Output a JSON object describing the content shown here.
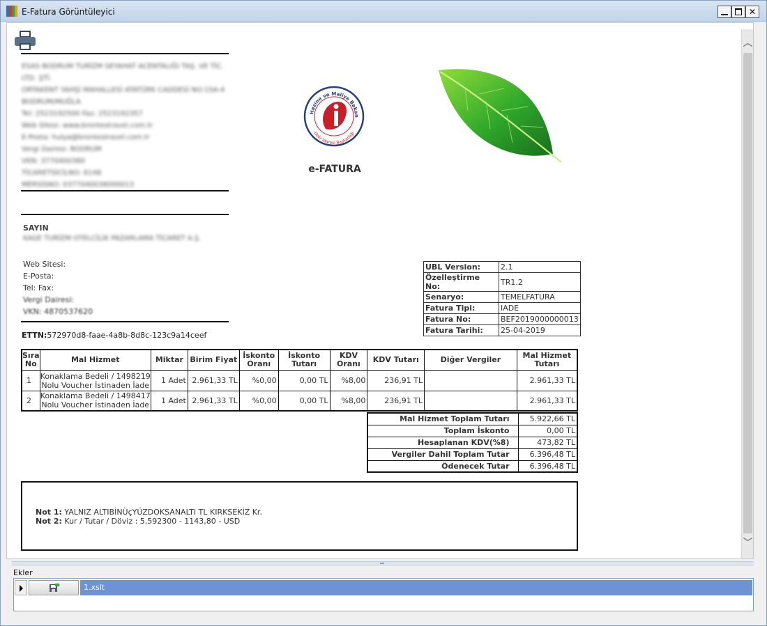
{
  "window": {
    "title": "E-Fatura Görüntüleyici"
  },
  "sender": {
    "lines": [
      "ESAS BODRUM TURİZM SEYAHAT ACENTALIĞI TAŞ. VE TİC.",
      "LTD. ŞTİ.",
      "ORTAKENT YAHŞİ MAHALLESİ ATATÜRK CADDESİ NO:15A-4",
      "BODRUM/MUĞLA",
      "Tel: 2523192500 Fax: 2523192357",
      "Web Sitesi: www.brontestravel.com.tr",
      "E-Posta: hulya@brontestravel.com.tr",
      "Vergi Dairesi: BODRUM",
      "VKN: 3770400380",
      "TİCARETSİCİLNO: 6148",
      "MERSİSNO: 0377040038000013"
    ]
  },
  "recipient": {
    "sayin": "SAYIN",
    "name": "KAGE TURİZM OTELCİLİK PAZARLAMA TİCARET A.Ş.",
    "web": "Web Sitesi:",
    "email": "E-Posta:",
    "tel": "Tel: Fax:",
    "tax_office": "Vergi Dairesi:",
    "vkn": "VKN: 4870537620"
  },
  "ettn": {
    "label": "ETTN:",
    "value": "572970d8-faae-4a8b-8d8c-123c9a14ceef"
  },
  "header": {
    "title": "e-FATURA"
  },
  "meta": [
    {
      "key": "UBL Version:",
      "value": "2.1"
    },
    {
      "key": "Özelleştirme No:",
      "value": "TR1.2"
    },
    {
      "key": "Senaryo:",
      "value": "TEMELFATURA"
    },
    {
      "key": "Fatura Tipi:",
      "value": "IADE"
    },
    {
      "key": "Fatura No:",
      "value": "BEF2019000000013"
    },
    {
      "key": "Fatura Tarihi:",
      "value": "25-04-2019"
    }
  ],
  "items": {
    "columns": [
      "Sıra No",
      "Mal Hizmet",
      "Miktar",
      "Birim Fiyat",
      "İskonto Oranı",
      "İskonto Tutarı",
      "KDV Oranı",
      "KDV Tutarı",
      "Diğer Vergiler",
      "Mal Hizmet Tutarı"
    ],
    "rows": [
      {
        "no": "1",
        "desc": "Konaklama Bedeli / 1498219 Nolu Voucher İstinaden İade",
        "qty": "1 Adet",
        "unit_price": "2.961,33 TL",
        "disc_rate": "%0,00",
        "disc_amount": "0,00 TL",
        "vat_rate": "%8,00",
        "vat_amount": "236,91 TL",
        "other_taxes": "",
        "amount": "2.961,33 TL"
      },
      {
        "no": "2",
        "desc": "Konaklama Bedeli / 1498417 Nolu Voucher İstinaden İade",
        "qty": "1 Adet",
        "unit_price": "2.961,33 TL",
        "disc_rate": "%0,00",
        "disc_amount": "0,00 TL",
        "vat_rate": "%8,00",
        "vat_amount": "236,91 TL",
        "other_taxes": "",
        "amount": "2.961,33 TL"
      }
    ]
  },
  "totals": [
    {
      "key": "Mal Hizmet Toplam Tutarı",
      "value": "5.922,66 TL"
    },
    {
      "key": "Toplam İskonto",
      "value": "0,00 TL"
    },
    {
      "key": "Hesaplanan KDV(%8)",
      "value": "473,82 TL"
    },
    {
      "key": "Vergiler Dahil Toplam Tutar",
      "value": "6.396,48 TL"
    },
    {
      "key": "Ödenecek Tutar",
      "value": "6.396,48 TL"
    }
  ],
  "notes": [
    {
      "label": "Not 1:",
      "text": "YALNIZ ALTIBİNÜçYÜZDOKSANALTI TL KIRKSEKİZ Kr."
    },
    {
      "label": "Not 2:",
      "text": "Kur / Tutar / Döviz : 5,592300 - 1143,80 - USD"
    }
  ],
  "gib_logo": {
    "arc_top": "T.C. Hazine ve Maliye Bakanlığı",
    "arc_bottom": "Gelir İdaresi Başkanlığı"
  },
  "attachments": {
    "label": "Ekler",
    "file": "1.xslt"
  },
  "icons": {
    "app": "app-icon",
    "printer": "printer-icon",
    "leaf": "leaf-icon",
    "save": "save-icon",
    "row": "row-pointer-icon"
  }
}
